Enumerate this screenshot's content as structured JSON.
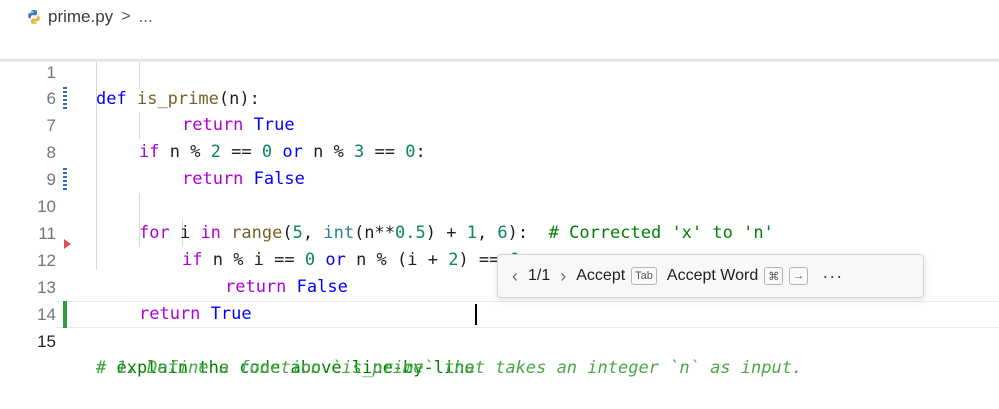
{
  "breadcrumb": {
    "file": "prime.py",
    "sep": ">",
    "tail": "..."
  },
  "lines": [
    {
      "num": "1",
      "tokens": [
        [
          "kb",
          "def"
        ],
        [
          "pl",
          " "
        ],
        [
          "fn",
          "is_prime"
        ],
        [
          "pl",
          "("
        ],
        [
          "pl",
          "n"
        ],
        [
          "pl",
          "):"
        ]
      ]
    },
    {
      "num": "6",
      "tokens": [
        [
          "kw",
          "return"
        ],
        [
          "pl",
          " "
        ],
        [
          "kb",
          "True"
        ]
      ]
    },
    {
      "num": "7",
      "tokens": [
        [
          "kw",
          "if"
        ],
        [
          "pl",
          " n % "
        ],
        [
          "num",
          "2"
        ],
        [
          "pl",
          " == "
        ],
        [
          "num",
          "0"
        ],
        [
          "pl",
          " "
        ],
        [
          "kb",
          "or"
        ],
        [
          "pl",
          " n % "
        ],
        [
          "num",
          "3"
        ],
        [
          "pl",
          " == "
        ],
        [
          "num",
          "0"
        ],
        [
          "pl",
          ":"
        ]
      ]
    },
    {
      "num": "8",
      "tokens": [
        [
          "kw",
          "return"
        ],
        [
          "pl",
          " "
        ],
        [
          "kb",
          "False"
        ]
      ]
    },
    {
      "num": "9",
      "tokens": []
    },
    {
      "num": "10",
      "tokens": [
        [
          "kw",
          "for"
        ],
        [
          "pl",
          " i "
        ],
        [
          "kw",
          "in"
        ],
        [
          "pl",
          " "
        ],
        [
          "fn",
          "range"
        ],
        [
          "pl",
          "("
        ],
        [
          "num",
          "5"
        ],
        [
          "pl",
          ", "
        ],
        [
          "bi",
          "int"
        ],
        [
          "pl",
          "(n**"
        ],
        [
          "num",
          "0.5"
        ],
        [
          "pl",
          ") + "
        ],
        [
          "num",
          "1"
        ],
        [
          "pl",
          ", "
        ],
        [
          "num",
          "6"
        ],
        [
          "pl",
          "):  "
        ],
        [
          "cm",
          "# Corrected 'x' to 'n'"
        ]
      ]
    },
    {
      "num": "11",
      "tokens": [
        [
          "kw",
          "if"
        ],
        [
          "pl",
          " n % i == "
        ],
        [
          "num",
          "0"
        ],
        [
          "pl",
          " "
        ],
        [
          "kb",
          "or"
        ],
        [
          "pl",
          " n % (i + "
        ],
        [
          "num",
          "2"
        ],
        [
          "pl",
          ") == "
        ],
        [
          "num",
          "0"
        ],
        [
          "pl",
          ":"
        ]
      ]
    },
    {
      "num": "12",
      "tokens": [
        [
          "kw",
          "return"
        ],
        [
          "pl",
          " "
        ],
        [
          "kb",
          "False"
        ]
      ]
    },
    {
      "num": "13",
      "tokens": [
        [
          "kw",
          "return"
        ],
        [
          "pl",
          " "
        ],
        [
          "kb",
          "True"
        ]
      ]
    },
    {
      "num": "14",
      "tokens": []
    },
    {
      "num": "15",
      "tokens": [
        [
          "cm",
          "# explain the code above line-by-line"
        ]
      ]
    }
  ],
  "ghost_text": "# 1. Define a function `is_prime` that takes an integer `n` as input.",
  "suggestion_widget": {
    "counter": "1/1",
    "accept_label": "Accept",
    "accept_key": "Tab",
    "accept_word_label": "Accept Word",
    "accept_word_key1": "⌘",
    "accept_word_key2": "→",
    "more": "···"
  }
}
